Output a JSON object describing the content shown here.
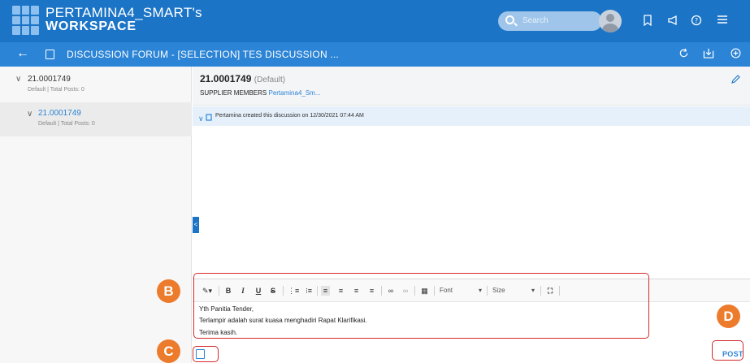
{
  "header": {
    "brand_line1": "PERTAMINA4_SMART's",
    "brand_line2": "WORKSPACE",
    "search_placeholder": "Search",
    "icons": [
      "bookmark-icon",
      "megaphone-icon",
      "help-icon",
      "menu-icon"
    ]
  },
  "subheader": {
    "title": "DISCUSSION FORUM - [SELECTION] TES DISCUSSION ...",
    "icons": [
      "refresh-icon",
      "export-icon",
      "add-icon"
    ]
  },
  "tree": {
    "items": [
      {
        "label": "21.0001749",
        "sub": "Default | Total Posts: 0"
      },
      {
        "label": "21.0001749",
        "sub": "Default | Total Posts: 0"
      }
    ]
  },
  "detail": {
    "title": "21.0001749",
    "tag": "(Default)",
    "members_label": "SUPPLIER MEMBERS",
    "members_link": "Pertamina4_Sm..."
  },
  "log": {
    "text": "Pertamina created this discussion on 12/30/2021 07:44 AM"
  },
  "editor": {
    "toolbar": {
      "bold": "B",
      "italic": "I",
      "underline": "U",
      "strike": "S",
      "font": "Font",
      "size": "Size"
    },
    "lines": [
      "Yth Panitia Tender,",
      "Terlampir adalah surat kuasa menghadiri Rapat Klarifikasi.",
      "Terima kasih."
    ],
    "post_label": "POST"
  },
  "annotations": {
    "b": "B",
    "c": "C",
    "d": "D",
    "color": "#d42a2a",
    "badge_color": "#ec7b2c"
  }
}
